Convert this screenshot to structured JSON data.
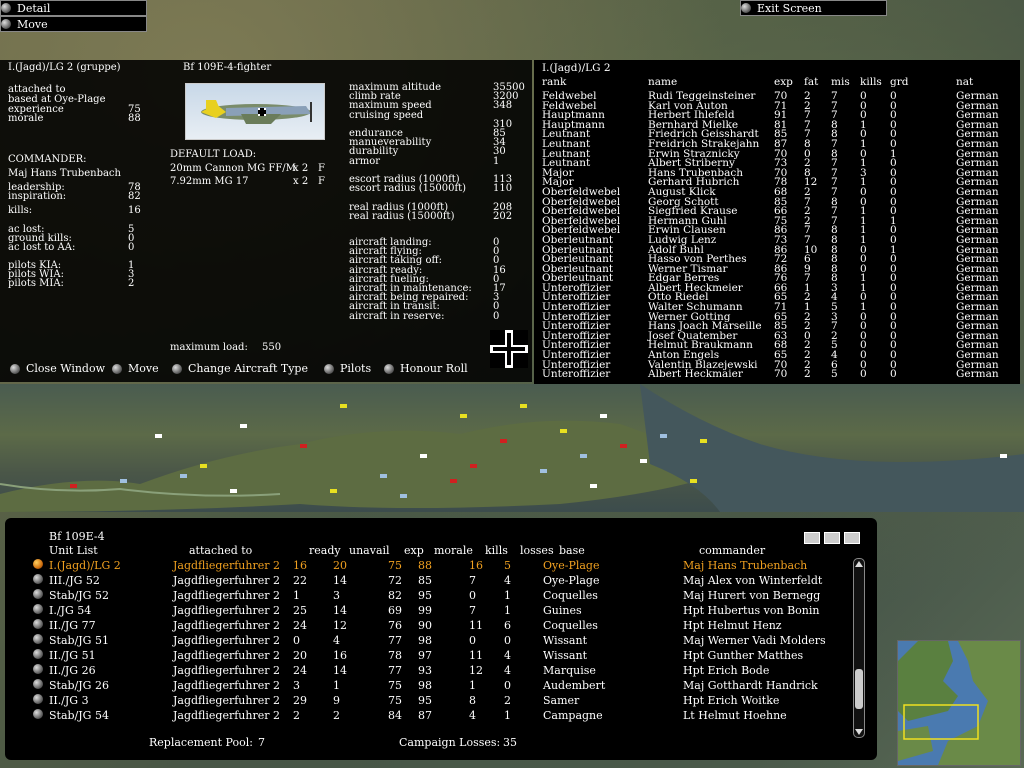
{
  "top_left": {
    "detail": "Detail",
    "move": "Move"
  },
  "top_right": {
    "exit": "Exit Screen"
  },
  "unit": {
    "header": "I.(Jagd)/LG 2 (gruppe)",
    "aircraft_type": "Bf 109E-4-fighter",
    "attached_label": "attached to",
    "based_label": "based at Oye-Plage",
    "experience_label": "experience",
    "experience": "75",
    "morale_label": "morale",
    "morale": "88",
    "commander_label": "COMMANDER:",
    "commander_name": "Maj Hans Trubenbach",
    "leadership_label": "leadership:",
    "leadership": "78",
    "inspiration_label": "inspiration:",
    "inspiration": "82",
    "kills_label": "kills:",
    "kills": "16",
    "ac_lost_label": "ac lost:",
    "ac_lost": "5",
    "ground_kills_label": "ground kills:",
    "ground_kills": "0",
    "ac_lost_aa_label": "ac lost to AA:",
    "ac_lost_aa": "0",
    "pilots_kia_label": "pilots KIA:",
    "pilots_kia": "1",
    "pilots_wia_label": "pilots WIA:",
    "pilots_wia": "3",
    "pilots_mia_label": "pilots MIA:",
    "pilots_mia": "2",
    "default_load_label": "DEFAULT LOAD:",
    "load1_name": "20mm Cannon MG FF/M",
    "load1_qty": "x 2",
    "load1_pos": "F",
    "load2_name": "7.92mm MG 17",
    "load2_qty": "x 2",
    "load2_pos": "F",
    "max_load_label": "maximum load:",
    "max_load": "550",
    "stats": [
      {
        "label": "maximum altitude",
        "value": "35500"
      },
      {
        "label": "climb rate",
        "value": "3200"
      },
      {
        "label": "maximum speed",
        "value": "348"
      },
      {
        "label": "cruising speed",
        "value": ""
      },
      {
        "label": "",
        "value": "310"
      },
      {
        "label": "endurance",
        "value": "85"
      },
      {
        "label": "manueverability",
        "value": "34"
      },
      {
        "label": "durability",
        "value": "30"
      },
      {
        "label": "armor",
        "value": "1"
      },
      {
        "label": "",
        "value": ""
      },
      {
        "label": "escort radius (1000ft)",
        "value": "113"
      },
      {
        "label": "escort radius (15000ft)",
        "value": "110"
      },
      {
        "label": "",
        "value": ""
      },
      {
        "label": "real radius (1000ft)",
        "value": "208"
      },
      {
        "label": "real radius (15000ft)",
        "value": "202"
      }
    ],
    "status": [
      {
        "label": "aircraft landing:",
        "value": "0"
      },
      {
        "label": "aircraft flying:",
        "value": "0"
      },
      {
        "label": "aircraft taking off:",
        "value": "0"
      },
      {
        "label": "aircraft ready:",
        "value": "16"
      },
      {
        "label": "aircraft fueling:",
        "value": "0"
      },
      {
        "label": "aircraft in maintenance:",
        "value": "17"
      },
      {
        "label": "aircraft being repaired:",
        "value": "3"
      },
      {
        "label": "aircraft in transit:",
        "value": "0"
      },
      {
        "label": "aircraft in reserve:",
        "value": "0"
      }
    ],
    "buttons": {
      "close": "Close Window",
      "move": "Move",
      "change": "Change Aircraft Type",
      "pilots": "Pilots",
      "honour": "Honour Roll"
    }
  },
  "pilots": {
    "title": "I.(Jagd)/LG 2",
    "headers": [
      "rank",
      "name",
      "exp",
      "fat",
      "mis",
      "kills",
      "grd",
      "nat"
    ],
    "rows": [
      [
        "Feldwebel",
        "Rudi Teggeinsteiner",
        "70",
        "2",
        "7",
        "0",
        "0",
        "German"
      ],
      [
        "Feldwebel",
        "Karl von Auton",
        "71",
        "2",
        "7",
        "0",
        "0",
        "German"
      ],
      [
        "Hauptmann",
        "Herbert Ihlefeld",
        "91",
        "7",
        "7",
        "0",
        "0",
        "German"
      ],
      [
        "Hauptmann",
        "Bernhard Mielke",
        "81",
        "7",
        "8",
        "1",
        "0",
        "German"
      ],
      [
        "Leutnant",
        "Friedrich Geisshardt",
        "85",
        "7",
        "8",
        "0",
        "0",
        "German"
      ],
      [
        "Leutnant",
        "Freidrich Strakejahn",
        "87",
        "8",
        "7",
        "1",
        "0",
        "German"
      ],
      [
        "Leutnant",
        "Erwin Straznicky",
        "70",
        "0",
        "8",
        "0",
        "1",
        "German"
      ],
      [
        "Leutnant",
        "Albert Striberny",
        "73",
        "2",
        "7",
        "1",
        "0",
        "German"
      ],
      [
        "Major",
        "Hans Trubenbach",
        "70",
        "8",
        "7",
        "3",
        "0",
        "German"
      ],
      [
        "Major",
        "Gerhard Hubrich",
        "78",
        "12",
        "7",
        "1",
        "0",
        "German"
      ],
      [
        "Oberfeldwebel",
        "August Klick",
        "68",
        "2",
        "7",
        "0",
        "0",
        "German"
      ],
      [
        "Oberfeldwebel",
        "Georg Schott",
        "85",
        "7",
        "8",
        "0",
        "0",
        "German"
      ],
      [
        "Oberfeldwebel",
        "Siegfried Krause",
        "66",
        "2",
        "7",
        "1",
        "0",
        "German"
      ],
      [
        "Oberfeldwebel",
        "Hermann Guhl",
        "75",
        "2",
        "7",
        "1",
        "1",
        "German"
      ],
      [
        "Oberfeldwebel",
        "Erwin Clausen",
        "86",
        "7",
        "8",
        "1",
        "0",
        "German"
      ],
      [
        "Oberleutnant",
        "Ludwig Lenz",
        "73",
        "7",
        "8",
        "1",
        "0",
        "German"
      ],
      [
        "Oberleutnant",
        "Adolf Buhl",
        "86",
        "10",
        "8",
        "0",
        "1",
        "German"
      ],
      [
        "Oberleutnant",
        "Hasso von Perthes",
        "72",
        "6",
        "8",
        "0",
        "0",
        "German"
      ],
      [
        "Oberleutnant",
        "Werner Tismar",
        "86",
        "9",
        "8",
        "0",
        "0",
        "German"
      ],
      [
        "Oberleutnant",
        "Edgar Berres",
        "76",
        "7",
        "8",
        "1",
        "0",
        "German"
      ],
      [
        "Unteroffizier",
        "Albert Heckmeier",
        "66",
        "1",
        "3",
        "1",
        "0",
        "German"
      ],
      [
        "Unteroffizier",
        "Otto Riedel",
        "65",
        "2",
        "4",
        "0",
        "0",
        "German"
      ],
      [
        "Unteroffizier",
        "Walter Schumann",
        "71",
        "1",
        "5",
        "1",
        "0",
        "German"
      ],
      [
        "Unteroffizier",
        "Werner Gotting",
        "65",
        "2",
        "3",
        "0",
        "0",
        "German"
      ],
      [
        "Unteroffizier",
        "Hans Joach Marseille",
        "85",
        "2",
        "7",
        "0",
        "0",
        "German"
      ],
      [
        "Unteroffizier",
        "Josef Quatember",
        "63",
        "0",
        "2",
        "0",
        "0",
        "German"
      ],
      [
        "Unteroffizier",
        "Helmut Braukmann",
        "68",
        "2",
        "5",
        "0",
        "0",
        "German"
      ],
      [
        "Unteroffizier",
        "Anton Engels",
        "65",
        "2",
        "4",
        "0",
        "0",
        "German"
      ],
      [
        "Unteroffizier",
        "Valentin Blazejewski",
        "70",
        "2",
        "6",
        "0",
        "0",
        "German"
      ],
      [
        "Unteroffizier",
        "Albert Heckmaier",
        "70",
        "2",
        "5",
        "0",
        "0",
        "German"
      ]
    ]
  },
  "unit_list": {
    "aircraft": "Bf 109E-4",
    "headers": [
      "Unit List",
      "attached to",
      "ready",
      "unavail",
      "exp",
      "morale",
      "kills",
      "losses",
      "base",
      "commander"
    ],
    "rows": [
      [
        "I.(Jagd)/LG 2",
        "Jagdfliegerfuhrer 2",
        "16",
        "20",
        "75",
        "88",
        "16",
        "5",
        "Oye-Plage",
        "Maj Hans Trubenbach"
      ],
      [
        "III./JG 52",
        "Jagdfliegerfuhrer 2",
        "22",
        "14",
        "72",
        "85",
        "7",
        "4",
        "Oye-Plage",
        "Maj Alex von Winterfeldt"
      ],
      [
        "Stab/JG 52",
        "Jagdfliegerfuhrer 2",
        "1",
        "3",
        "82",
        "95",
        "0",
        "1",
        "Coquelles",
        "Maj Hurert von Bernegg"
      ],
      [
        "I./JG 54",
        "Jagdfliegerfuhrer 2",
        "25",
        "14",
        "69",
        "99",
        "7",
        "1",
        "Guines",
        "Hpt Hubertus von Bonin"
      ],
      [
        "II./JG 77",
        "Jagdfliegerfuhrer 2",
        "24",
        "12",
        "76",
        "90",
        "11",
        "6",
        "Coquelles",
        "Hpt Helmut Henz"
      ],
      [
        "Stab/JG 51",
        "Jagdfliegerfuhrer 2",
        "0",
        "4",
        "77",
        "98",
        "0",
        "0",
        "Wissant",
        "Maj Werner Vadi Molders"
      ],
      [
        "II./JG 51",
        "Jagdfliegerfuhrer 2",
        "20",
        "16",
        "78",
        "97",
        "11",
        "4",
        "Wissant",
        "Hpt Gunther Matthes"
      ],
      [
        "II./JG 26",
        "Jagdfliegerfuhrer 2",
        "24",
        "14",
        "77",
        "93",
        "12",
        "4",
        "Marquise",
        "Hpt Erich Bode"
      ],
      [
        "Stab/JG 26",
        "Jagdfliegerfuhrer 2",
        "3",
        "1",
        "75",
        "98",
        "1",
        "0",
        "Audembert",
        "Maj Gotthardt Handrick"
      ],
      [
        "II./JG 3",
        "Jagdfliegerfuhrer 2",
        "29",
        "9",
        "75",
        "95",
        "8",
        "2",
        "Samer",
        "Hpt Erich Woitke"
      ],
      [
        "Stab/JG 54",
        "Jagdfliegerfuhrer 2",
        "2",
        "2",
        "84",
        "87",
        "4",
        "1",
        "Campagne",
        "Lt Helmut Hoehne"
      ]
    ],
    "replacement_label": "Replacement Pool:",
    "replacement": "7",
    "campaign_losses_label": "Campaign Losses:",
    "campaign_losses": "35"
  },
  "colors": {
    "highlight": "#f0a020",
    "panel": "#000000"
  }
}
